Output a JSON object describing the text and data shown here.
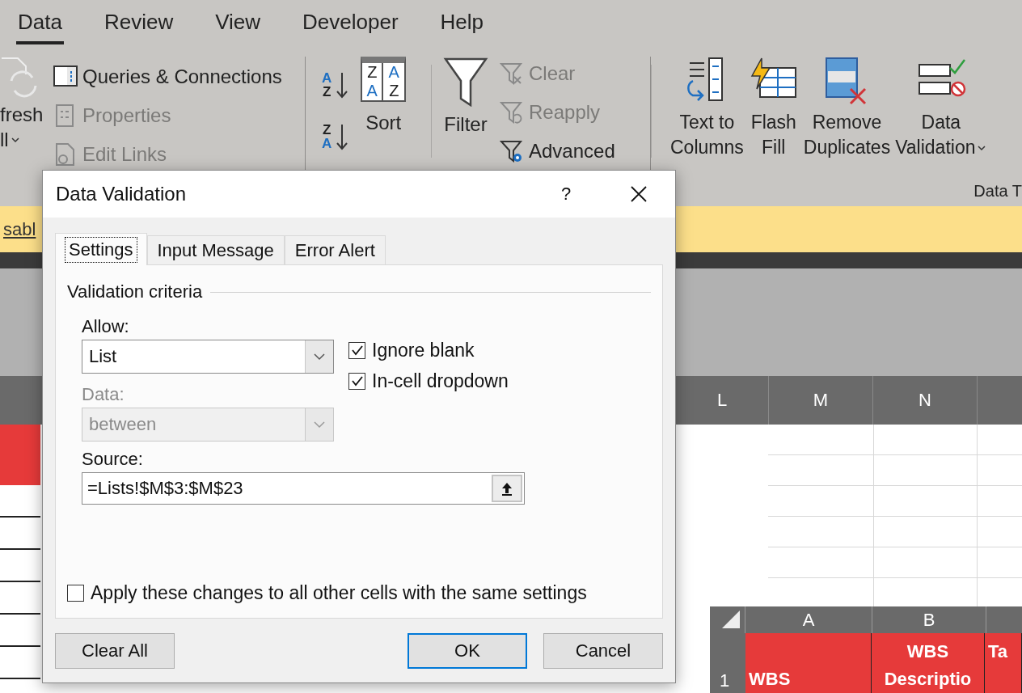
{
  "ribbon": {
    "tabs": [
      {
        "label": "Data",
        "selected": true
      },
      {
        "label": "Review",
        "selected": false
      },
      {
        "label": "View",
        "selected": false
      },
      {
        "label": "Developer",
        "selected": false
      },
      {
        "label": "Help",
        "selected": false
      }
    ],
    "queries_group": {
      "refresh_button": {
        "line_1": "fresh",
        "line_2": "ll"
      },
      "commands": [
        {
          "label": "Queries & Connections",
          "disabled": false,
          "kind": "queries"
        },
        {
          "label": "Properties",
          "disabled": true,
          "kind": "properties"
        },
        {
          "label": "Edit Links",
          "disabled": true,
          "kind": "links"
        }
      ]
    },
    "sort_group": {
      "ascending_letters": [
        "A",
        "Z"
      ],
      "descending_letters": [
        "Z",
        "A"
      ],
      "sort_icon_letters": [
        "Z",
        "A",
        "A",
        "Z"
      ],
      "sort_button": "Sort"
    },
    "filter_group": {
      "filter_button": "Filter",
      "commands": [
        {
          "label": "Clear",
          "disabled": true,
          "kind": "clear"
        },
        {
          "label": "Reapply",
          "disabled": true,
          "kind": "reapply"
        },
        {
          "label": "Advanced",
          "disabled": false,
          "kind": "advanced"
        }
      ]
    },
    "data_tools_group": {
      "label": "Data T",
      "buttons": [
        {
          "lines": [
            "Text to",
            "Columns"
          ],
          "kind": "text_to_columns",
          "dropdown": false
        },
        {
          "lines": [
            "Flash",
            "Fill"
          ],
          "kind": "flash_fill",
          "dropdown": false
        },
        {
          "lines": [
            "Remove",
            "Duplicates"
          ],
          "kind": "remove_duplicates",
          "dropdown": false
        },
        {
          "lines": [
            "Data",
            "Validation"
          ],
          "kind": "data_validation",
          "dropdown": true
        }
      ]
    }
  },
  "message_bar": {
    "link": "sabl"
  },
  "sheet": {
    "columns": [
      "L",
      "M",
      "N"
    ]
  },
  "dialog": {
    "title": "Data Validation",
    "help": "?",
    "tabs": [
      {
        "label": "Settings",
        "selected": true
      },
      {
        "label": "Input Message",
        "selected": false
      },
      {
        "label": "Error Alert",
        "selected": false
      }
    ],
    "section_title": "Validation criteria",
    "allow": {
      "label": "Allow:",
      "value": "List",
      "disabled": false
    },
    "data": {
      "label": "Data:",
      "value": "between",
      "disabled": true
    },
    "checkboxes": [
      {
        "label": "Ignore blank",
        "checked": true
      },
      {
        "label": "In-cell dropdown",
        "checked": true
      }
    ],
    "source": {
      "label": "Source:",
      "value": "=Lists!$M$3:$M$23"
    },
    "apply_all": {
      "label": "Apply these changes to all other cells with the same settings",
      "checked": false
    },
    "buttons": [
      {
        "label": "Clear All",
        "default": false
      },
      {
        "label": "OK",
        "default": true
      },
      {
        "label": "Cancel",
        "default": false
      }
    ]
  },
  "inset_sheet": {
    "columns": [
      "A",
      "B"
    ],
    "row": {
      "number": "1",
      "cells": [
        "WBS",
        "WBS Descriptio",
        "Ta"
      ]
    }
  }
}
